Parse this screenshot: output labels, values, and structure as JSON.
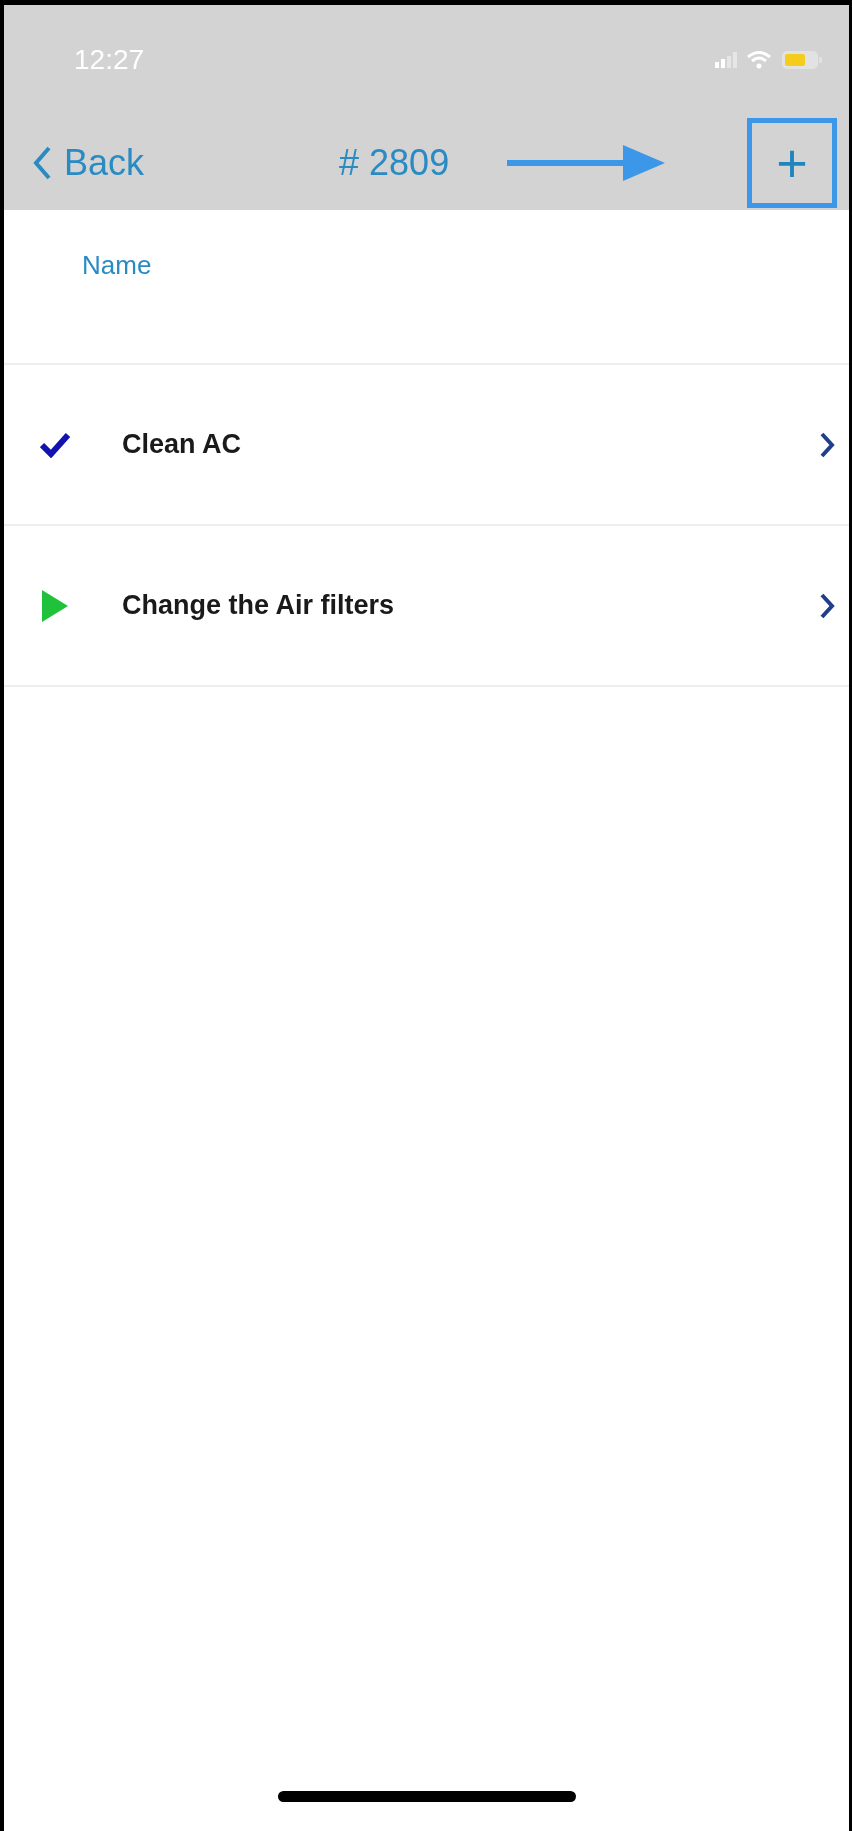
{
  "status_bar": {
    "time": "12:27"
  },
  "nav": {
    "back": "Back",
    "title": "# 2809",
    "add": "+",
    "add_highlighted": true
  },
  "column_header": "Name",
  "tasks": [
    {
      "name": "Clean AC",
      "kind": "done"
    },
    {
      "name": "Change the Air filters",
      "kind": "started"
    }
  ]
}
